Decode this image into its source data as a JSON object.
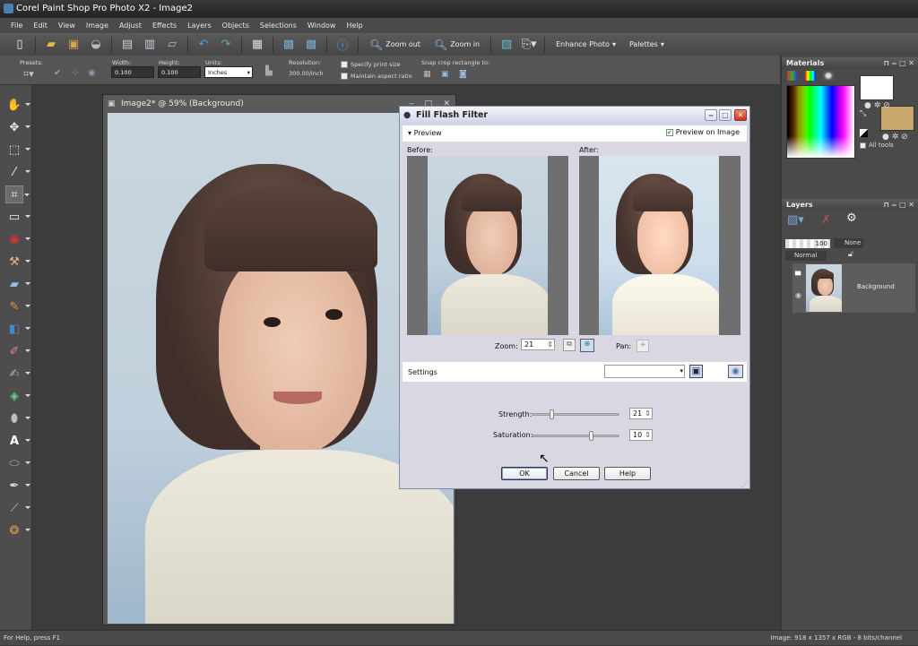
{
  "app": {
    "title": "Corel Paint Shop Pro Photo X2 - Image2"
  },
  "menu": [
    "File",
    "Edit",
    "View",
    "Image",
    "Adjust",
    "Effects",
    "Layers",
    "Objects",
    "Selections",
    "Window",
    "Help"
  ],
  "toolbar": {
    "zoom_out": "Zoom out",
    "zoom_in": "Zoom in",
    "enhance_photo": "Enhance Photo",
    "palettes": "Palettes"
  },
  "options": {
    "presets": "Presets:",
    "width_label": "Width:",
    "width": "0.100",
    "height_label": "Height:",
    "height": "0.100",
    "units_label": "Units:",
    "units": "Inches",
    "resolution_label": "Resolution:",
    "resolution": "300.00/inch",
    "specify_print_size": "Specify print size",
    "maintain_aspect": "Maintain aspect ratio",
    "snap_label": "Snap crop rectangle to:"
  },
  "image_window": {
    "title": "Image2* @  59% (Background)"
  },
  "dialog": {
    "title": "Fill Flash Filter",
    "preview": "Preview",
    "preview_on_image": "Preview on Image",
    "preview_on_image_checked": true,
    "before": "Before:",
    "after": "After:",
    "zoom_label": "Zoom:",
    "zoom": "21",
    "pan_label": "Pan:",
    "settings_label": "Settings",
    "settings_value": "",
    "strength_label": "Strength:",
    "strength": 21,
    "saturation_label": "Saturation:",
    "saturation": 10,
    "ok": "OK",
    "cancel": "Cancel",
    "help": "Help"
  },
  "materials": {
    "title": "Materials",
    "all_tools": "All tools",
    "fg_color": "#ffffff",
    "bg_color": "#c8a96b"
  },
  "layers": {
    "title": "Layers",
    "opacity": "100",
    "mask": "None",
    "blend": "Normal",
    "layer_name": "Background"
  },
  "status": {
    "help": "For Help, press F1",
    "image_info": "Image:  918 x 1357 x RGB - 8 bits/channel"
  }
}
